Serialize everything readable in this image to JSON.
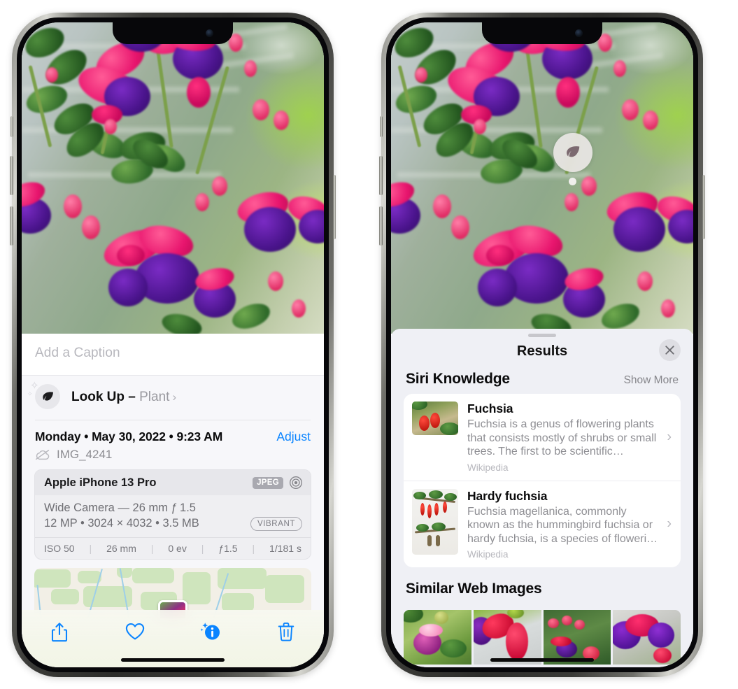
{
  "left_phone": {
    "name": "photos-detail-view",
    "photo": {
      "alt": "fuchsia-flowers-photo"
    },
    "caption": {
      "placeholder": "Add a Caption",
      "value": ""
    },
    "look_up": {
      "icon": "leaf-icon",
      "label": "Look Up",
      "dash": "–",
      "subject": "Plant",
      "chevron": "›"
    },
    "date_line": "Monday • May 30, 2022 • 9:23 AM",
    "adjust_label": "Adjust",
    "filename": "IMG_4241",
    "filename_icon": "cloud-slash-icon",
    "exif": {
      "device": "Apple iPhone 13 Pro",
      "format_badge": "JPEG",
      "aperture_icon": "aperture-icon",
      "lens_line": "Wide Camera — 26 mm ƒ 1.5",
      "size_line": "12 MP • 3024 × 4032 • 3.5 MB",
      "style_badge": "VIBRANT",
      "stats": [
        "ISO 50",
        "26 mm",
        "0 ev",
        "ƒ1.5",
        "1/181 s"
      ]
    },
    "map": {
      "name": "location-map-preview",
      "pin": "photo-thumbnail-pin"
    },
    "toolbar": [
      {
        "name": "share-button",
        "icon": "share-icon"
      },
      {
        "name": "favorite-button",
        "icon": "heart-icon"
      },
      {
        "name": "info-button",
        "icon": "info-sparkle-icon"
      },
      {
        "name": "delete-button",
        "icon": "trash-icon"
      }
    ],
    "accent_color": "#0a84ff"
  },
  "right_phone": {
    "name": "visual-look-up-results",
    "badge": {
      "icon": "leaf-icon",
      "label": "visual-look-up-badge"
    },
    "sheet": {
      "title": "Results",
      "close_icon": "close-icon",
      "sections": [
        {
          "name": "siri-knowledge",
          "title": "Siri Knowledge",
          "action": "Show More",
          "items": [
            {
              "title": "Fuchsia",
              "description": "Fuchsia is a genus of flowering plants that consists mostly of shrubs or small trees. The first to be scientific…",
              "source": "Wikipedia",
              "thumb": "fuchsia-red-flowers-thumbnail",
              "chevron": "›"
            },
            {
              "title": "Hardy fuchsia",
              "description": "Fuchsia magellanica, commonly known as the hummingbird fuchsia or hardy fuchsia, is a species of floweri…",
              "source": "Wikipedia",
              "thumb": "hardy-fuchsia-branch-thumbnail",
              "chevron": "›"
            }
          ]
        },
        {
          "name": "similar-web-images",
          "title": "Similar Web Images",
          "images": [
            {
              "name": "web-image-1"
            },
            {
              "name": "web-image-2"
            },
            {
              "name": "web-image-3"
            },
            {
              "name": "web-image-4"
            }
          ]
        }
      ]
    }
  },
  "colors": {
    "accent": "#0a84ff",
    "sheet_bg_left": "#f7f7fa",
    "sheet_bg_right": "#eff0f5",
    "card_bg": "#ffffff",
    "secondary_text": "#8e8e93"
  }
}
